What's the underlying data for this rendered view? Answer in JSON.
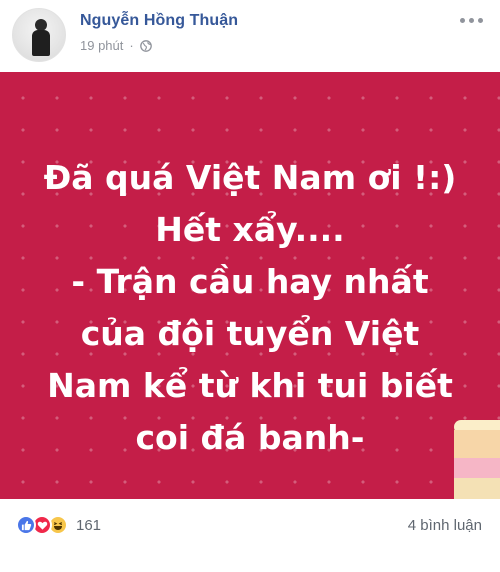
{
  "post": {
    "author": "Nguyễn Hồng Thuận",
    "time": "19 phút",
    "separator": "·",
    "privacy_icon": "globe-icon",
    "status_lines": [
      "Đã quá Việt Nam ơi !:)",
      "Hết xẩy....",
      "- Trận cầu hay nhất",
      "của đội tuyển Việt",
      "Nam kể từ khi tui biết",
      "coi đá banh-"
    ],
    "background_color": "#c41e48",
    "text_color": "#ffffff",
    "reactions": {
      "icons": [
        "like-icon",
        "love-icon",
        "haha-icon"
      ],
      "count": "161"
    },
    "comments_label": "4 bình luận"
  }
}
